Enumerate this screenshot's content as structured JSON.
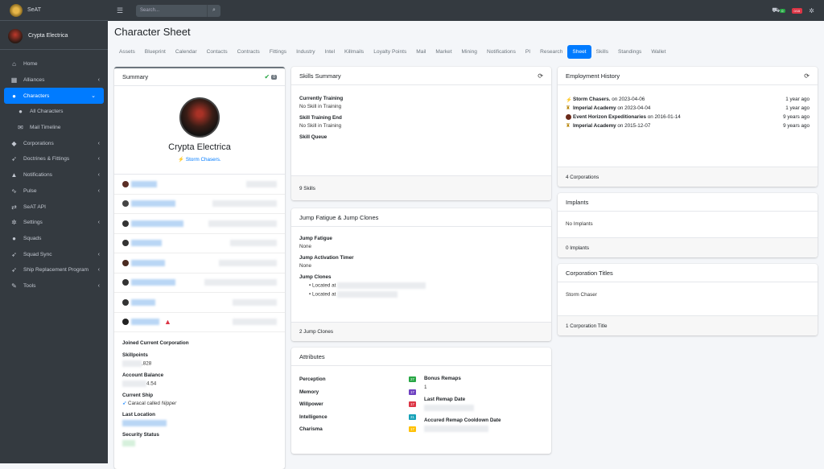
{
  "sidebar": {
    "brand": "SeAT",
    "user": "Crypta Electrica",
    "items": [
      {
        "label": "Home",
        "icon": "home-icon",
        "glyph": "⌂"
      },
      {
        "label": "Alliances",
        "icon": "building-icon",
        "glyph": "▦"
      },
      {
        "label": "Characters",
        "icon": "user-icon",
        "glyph": "●"
      },
      {
        "label": "All Characters",
        "icon": "users-icon",
        "glyph": "●"
      },
      {
        "label": "Mail Timeline",
        "icon": "mail-icon",
        "glyph": "✉"
      },
      {
        "label": "Corporations",
        "icon": "corporation-icon",
        "glyph": "◆"
      },
      {
        "label": "Doctrines & Fittings",
        "icon": "rocket-icon",
        "glyph": "➶"
      },
      {
        "label": "Notifications",
        "icon": "bell-icon",
        "glyph": "▲"
      },
      {
        "label": "Pulse",
        "icon": "pulse-icon",
        "glyph": "∿"
      },
      {
        "label": "SeAT API",
        "icon": "exchange-icon",
        "glyph": "⇄"
      },
      {
        "label": "Settings",
        "icon": "cogs-icon",
        "glyph": "✲"
      },
      {
        "label": "Squads",
        "icon": "group-icon",
        "glyph": "●"
      },
      {
        "label": "Squad Sync",
        "icon": "rocket-icon",
        "glyph": "➶"
      },
      {
        "label": "Ship Replacement Program",
        "icon": "rocket-icon",
        "glyph": "➶"
      },
      {
        "label": "Tools",
        "icon": "wrench-icon",
        "glyph": "✎"
      }
    ]
  },
  "topbar": {
    "search_placeholder": "Search...",
    "badge_green": "0",
    "badge_red": "0/15"
  },
  "page_title": "Character Sheet",
  "tabs": [
    "Assets",
    "Blueprint",
    "Calendar",
    "Contacts",
    "Contracts",
    "Fittings",
    "Industry",
    "Intel",
    "Killmails",
    "Loyalty Points",
    "Mail",
    "Market",
    "Mining",
    "Notifications",
    "PI",
    "Research",
    "Sheet",
    "Skills",
    "Standings",
    "Wallet"
  ],
  "summary": {
    "title": "Summary",
    "badge": "0",
    "name": "Crypta Electrica",
    "corp": "Storm Chasers.",
    "joined_label": "Joined Current Corporation",
    "skillpoints_label": "Skillpoints",
    "skillpoints_value": ",828",
    "balance_label": "Account Balance",
    "balance_value": "4.54",
    "ship_label": "Current Ship",
    "ship_value": "Caracal called",
    "ship_name": "Nipper",
    "location_label": "Last Location",
    "security_label": "Security Status"
  },
  "skills_summary": {
    "title": "Skills Summary",
    "training_label": "Currently Training",
    "training_value": "No Skill in Training",
    "end_label": "Skill Training End",
    "end_value": "No Skill in Training",
    "queue_label": "Skill Queue",
    "footer": "9 Skills"
  },
  "jump": {
    "title": "Jump Fatigue & Jump Clones",
    "fatigue_label": "Jump Fatigue",
    "fatigue_value": "None",
    "timer_label": "Jump Activation Timer",
    "timer_value": "None",
    "clones_label": "Jump Clones",
    "clone1": "Located at",
    "clone2": "Located at",
    "footer": "2 Jump Clones"
  },
  "attributes": {
    "title": "Attributes",
    "rows": [
      {
        "label": "Perception",
        "value": "27",
        "color": "#28a745"
      },
      {
        "label": "Memory",
        "value": "17",
        "color": "#6f42c1"
      },
      {
        "label": "Willpower",
        "value": "17",
        "color": "#dc3545"
      },
      {
        "label": "Intelligence",
        "value": "21",
        "color": "#17a2b8"
      },
      {
        "label": "Charisma",
        "value": "17",
        "color": "#ffc107"
      }
    ],
    "remaps_label": "Bonus Remaps",
    "remaps_value": "1",
    "last_remap_label": "Last Remap Date",
    "cooldown_label": "Accured Remap Cooldown Date"
  },
  "employment": {
    "title": "Employment History",
    "rows": [
      {
        "corp": "Storm Chasers.",
        "date": "on 2023-04-06",
        "ago": "1 year ago"
      },
      {
        "corp": "Imperial Academy",
        "date": "on 2023-04-04",
        "ago": "1 year ago"
      },
      {
        "corp": "Event Horizon Expeditionaries",
        "date": "on 2016-01-14",
        "ago": "9 years ago"
      },
      {
        "corp": "Imperial Academy",
        "date": "on 2015-12-07",
        "ago": "9 years ago"
      }
    ],
    "footer": "4 Corporations"
  },
  "implants": {
    "title": "Implants",
    "body": "No Implants",
    "footer": "0 Implants"
  },
  "titles": {
    "title": "Corporation Titles",
    "body": "Storm Chaser",
    "footer": "1 Corporation Title"
  }
}
